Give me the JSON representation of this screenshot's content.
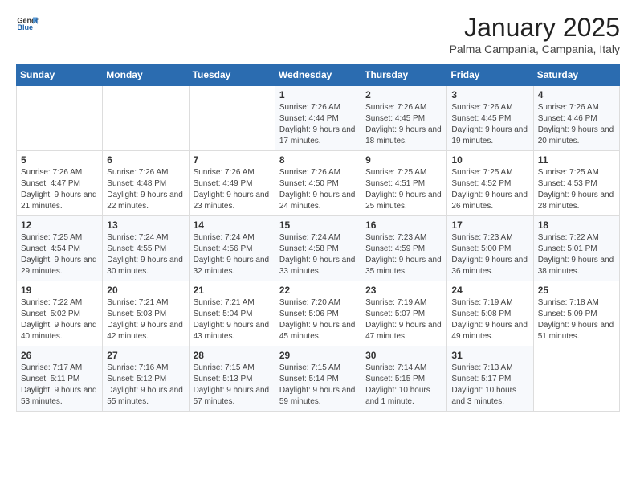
{
  "header": {
    "logo_general": "General",
    "logo_blue": "Blue",
    "month_title": "January 2025",
    "location": "Palma Campania, Campania, Italy"
  },
  "weekdays": [
    "Sunday",
    "Monday",
    "Tuesday",
    "Wednesday",
    "Thursday",
    "Friday",
    "Saturday"
  ],
  "weeks": [
    [
      {
        "day": "",
        "sunrise": "",
        "sunset": "",
        "daylight": ""
      },
      {
        "day": "",
        "sunrise": "",
        "sunset": "",
        "daylight": ""
      },
      {
        "day": "",
        "sunrise": "",
        "sunset": "",
        "daylight": ""
      },
      {
        "day": "1",
        "sunrise": "Sunrise: 7:26 AM",
        "sunset": "Sunset: 4:44 PM",
        "daylight": "Daylight: 9 hours and 17 minutes."
      },
      {
        "day": "2",
        "sunrise": "Sunrise: 7:26 AM",
        "sunset": "Sunset: 4:45 PM",
        "daylight": "Daylight: 9 hours and 18 minutes."
      },
      {
        "day": "3",
        "sunrise": "Sunrise: 7:26 AM",
        "sunset": "Sunset: 4:45 PM",
        "daylight": "Daylight: 9 hours and 19 minutes."
      },
      {
        "day": "4",
        "sunrise": "Sunrise: 7:26 AM",
        "sunset": "Sunset: 4:46 PM",
        "daylight": "Daylight: 9 hours and 20 minutes."
      }
    ],
    [
      {
        "day": "5",
        "sunrise": "Sunrise: 7:26 AM",
        "sunset": "Sunset: 4:47 PM",
        "daylight": "Daylight: 9 hours and 21 minutes."
      },
      {
        "day": "6",
        "sunrise": "Sunrise: 7:26 AM",
        "sunset": "Sunset: 4:48 PM",
        "daylight": "Daylight: 9 hours and 22 minutes."
      },
      {
        "day": "7",
        "sunrise": "Sunrise: 7:26 AM",
        "sunset": "Sunset: 4:49 PM",
        "daylight": "Daylight: 9 hours and 23 minutes."
      },
      {
        "day": "8",
        "sunrise": "Sunrise: 7:26 AM",
        "sunset": "Sunset: 4:50 PM",
        "daylight": "Daylight: 9 hours and 24 minutes."
      },
      {
        "day": "9",
        "sunrise": "Sunrise: 7:25 AM",
        "sunset": "Sunset: 4:51 PM",
        "daylight": "Daylight: 9 hours and 25 minutes."
      },
      {
        "day": "10",
        "sunrise": "Sunrise: 7:25 AM",
        "sunset": "Sunset: 4:52 PM",
        "daylight": "Daylight: 9 hours and 26 minutes."
      },
      {
        "day": "11",
        "sunrise": "Sunrise: 7:25 AM",
        "sunset": "Sunset: 4:53 PM",
        "daylight": "Daylight: 9 hours and 28 minutes."
      }
    ],
    [
      {
        "day": "12",
        "sunrise": "Sunrise: 7:25 AM",
        "sunset": "Sunset: 4:54 PM",
        "daylight": "Daylight: 9 hours and 29 minutes."
      },
      {
        "day": "13",
        "sunrise": "Sunrise: 7:24 AM",
        "sunset": "Sunset: 4:55 PM",
        "daylight": "Daylight: 9 hours and 30 minutes."
      },
      {
        "day": "14",
        "sunrise": "Sunrise: 7:24 AM",
        "sunset": "Sunset: 4:56 PM",
        "daylight": "Daylight: 9 hours and 32 minutes."
      },
      {
        "day": "15",
        "sunrise": "Sunrise: 7:24 AM",
        "sunset": "Sunset: 4:58 PM",
        "daylight": "Daylight: 9 hours and 33 minutes."
      },
      {
        "day": "16",
        "sunrise": "Sunrise: 7:23 AM",
        "sunset": "Sunset: 4:59 PM",
        "daylight": "Daylight: 9 hours and 35 minutes."
      },
      {
        "day": "17",
        "sunrise": "Sunrise: 7:23 AM",
        "sunset": "Sunset: 5:00 PM",
        "daylight": "Daylight: 9 hours and 36 minutes."
      },
      {
        "day": "18",
        "sunrise": "Sunrise: 7:22 AM",
        "sunset": "Sunset: 5:01 PM",
        "daylight": "Daylight: 9 hours and 38 minutes."
      }
    ],
    [
      {
        "day": "19",
        "sunrise": "Sunrise: 7:22 AM",
        "sunset": "Sunset: 5:02 PM",
        "daylight": "Daylight: 9 hours and 40 minutes."
      },
      {
        "day": "20",
        "sunrise": "Sunrise: 7:21 AM",
        "sunset": "Sunset: 5:03 PM",
        "daylight": "Daylight: 9 hours and 42 minutes."
      },
      {
        "day": "21",
        "sunrise": "Sunrise: 7:21 AM",
        "sunset": "Sunset: 5:04 PM",
        "daylight": "Daylight: 9 hours and 43 minutes."
      },
      {
        "day": "22",
        "sunrise": "Sunrise: 7:20 AM",
        "sunset": "Sunset: 5:06 PM",
        "daylight": "Daylight: 9 hours and 45 minutes."
      },
      {
        "day": "23",
        "sunrise": "Sunrise: 7:19 AM",
        "sunset": "Sunset: 5:07 PM",
        "daylight": "Daylight: 9 hours and 47 minutes."
      },
      {
        "day": "24",
        "sunrise": "Sunrise: 7:19 AM",
        "sunset": "Sunset: 5:08 PM",
        "daylight": "Daylight: 9 hours and 49 minutes."
      },
      {
        "day": "25",
        "sunrise": "Sunrise: 7:18 AM",
        "sunset": "Sunset: 5:09 PM",
        "daylight": "Daylight: 9 hours and 51 minutes."
      }
    ],
    [
      {
        "day": "26",
        "sunrise": "Sunrise: 7:17 AM",
        "sunset": "Sunset: 5:11 PM",
        "daylight": "Daylight: 9 hours and 53 minutes."
      },
      {
        "day": "27",
        "sunrise": "Sunrise: 7:16 AM",
        "sunset": "Sunset: 5:12 PM",
        "daylight": "Daylight: 9 hours and 55 minutes."
      },
      {
        "day": "28",
        "sunrise": "Sunrise: 7:15 AM",
        "sunset": "Sunset: 5:13 PM",
        "daylight": "Daylight: 9 hours and 57 minutes."
      },
      {
        "day": "29",
        "sunrise": "Sunrise: 7:15 AM",
        "sunset": "Sunset: 5:14 PM",
        "daylight": "Daylight: 9 hours and 59 minutes."
      },
      {
        "day": "30",
        "sunrise": "Sunrise: 7:14 AM",
        "sunset": "Sunset: 5:15 PM",
        "daylight": "Daylight: 10 hours and 1 minute."
      },
      {
        "day": "31",
        "sunrise": "Sunrise: 7:13 AM",
        "sunset": "Sunset: 5:17 PM",
        "daylight": "Daylight: 10 hours and 3 minutes."
      },
      {
        "day": "",
        "sunrise": "",
        "sunset": "",
        "daylight": ""
      }
    ]
  ]
}
